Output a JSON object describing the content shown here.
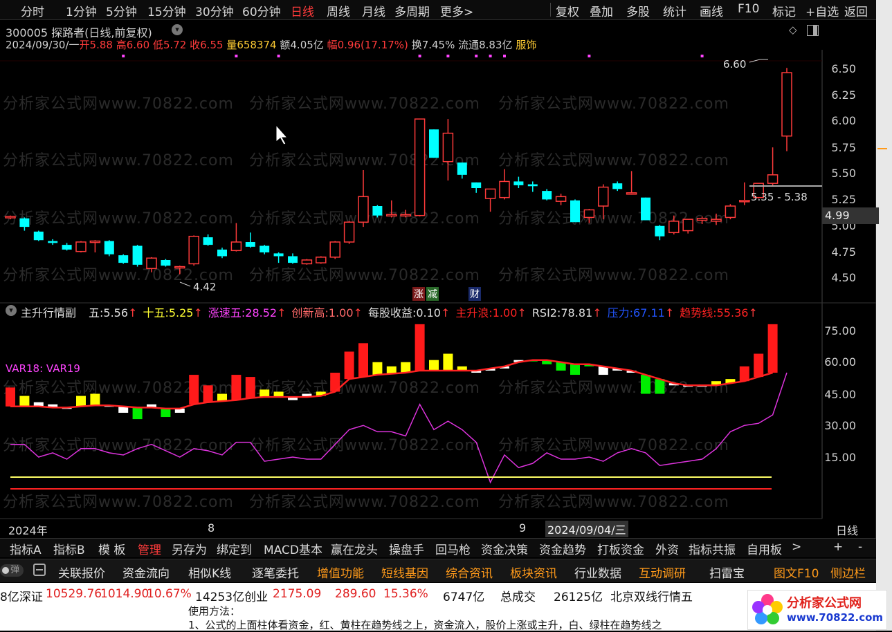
{
  "toolbar": {
    "left": [
      "分时",
      "1分钟",
      "5分钟",
      "15分钟",
      "30分钟",
      "60分钟",
      "日线",
      "周线",
      "月线",
      "多周期",
      "更多>"
    ],
    "active": "日线",
    "right": [
      "复权",
      "叠加",
      "多股",
      "统计",
      "画线",
      "F10",
      "标记",
      "+自选",
      "返回"
    ]
  },
  "stock": {
    "title": "300005 探路者(日线,前复权)",
    "date": "2024/09/30/一",
    "open_label": "开",
    "open": "5.88",
    "high_label": "高",
    "high": "6.60",
    "low_label": "低",
    "low": "5.72",
    "close_label": "收",
    "close": "6.55",
    "vol_label": "量",
    "vol": "658374",
    "amount": "额4.05亿",
    "change_label": "幅",
    "change": "0.96(17.17%)",
    "turnover": "换7.45%",
    "float": "流通8.83亿",
    "sector": "服饰"
  },
  "price_axis": [
    "6.50",
    "6.25",
    "6.00",
    "5.75",
    "5.50",
    "5.25",
    "5.00",
    "4.75",
    "4.50"
  ],
  "annotations": {
    "high_marker": "6.60",
    "low_marker": "4.42",
    "range_box": "5.35 - 5.38",
    "current_price": "4.99",
    "badge_zhang": "涨",
    "badge_jian": "减",
    "badge_cai": "财"
  },
  "indicator": {
    "name": "主升行情副",
    "items": [
      {
        "label": "五:",
        "value": "5.56",
        "color": "#e0e0e0"
      },
      {
        "label": "十五:",
        "value": "5.25",
        "color": "#ffff33"
      },
      {
        "label": "涨速五:",
        "value": "28.52",
        "color": "#ff44ff"
      },
      {
        "label": "创新高:",
        "value": "1.00",
        "color": "#ff6a6a"
      },
      {
        "label": "每股收益:",
        "value": "0.10",
        "color": "#e0e0e0"
      },
      {
        "label": "主升浪:",
        "value": "1.00",
        "color": "#ff2222"
      },
      {
        "label": "RSI2:",
        "value": "78.81",
        "color": "#e0e0e0"
      },
      {
        "label": "压力:",
        "value": "67.11",
        "color": "#2255ff"
      },
      {
        "label": "趋势线:",
        "value": "55.36",
        "color": "#ff2222"
      }
    ],
    "var_label": "VAR18: VAR19",
    "axis": [
      "75.00",
      "60.00",
      "45.00",
      "30.00",
      "15.00"
    ]
  },
  "time_axis": {
    "year": "2024年",
    "m8": "8",
    "m9": "9",
    "cursor_date": "2024/09/04/三",
    "period": "日线"
  },
  "watermark": "分析家公式网www.70822.com",
  "tabs": [
    "指标A",
    "指标B",
    "模 板",
    "管理",
    "另存为",
    "绑定到",
    "MACD基本",
    "赢在龙头",
    "操盘手",
    "回马枪",
    "资金决策",
    "资金趋势",
    "打板资金",
    "外资",
    "指标共振",
    "自用板",
    ">",
    "+",
    "-"
  ],
  "tabs_active": "管理",
  "funcbar": {
    "toggle": "弹",
    "items": [
      {
        "label": "关联报价",
        "orange": false
      },
      {
        "label": "资金流向",
        "orange": false
      },
      {
        "label": "相似K线",
        "orange": false
      },
      {
        "label": "逐笔委托",
        "orange": false
      },
      {
        "label": "增值功能",
        "orange": true
      },
      {
        "label": "短线基因",
        "orange": true
      },
      {
        "label": "综合资讯",
        "orange": true
      },
      {
        "label": "板块资讯",
        "orange": true
      },
      {
        "label": "行业数据",
        "orange": false
      },
      {
        "label": "互动调研",
        "orange": true
      },
      {
        "label": "扫雷宝",
        "orange": false
      },
      {
        "label": "图文F10",
        "orange": true
      },
      {
        "label": "侧边栏",
        "orange": true
      }
    ]
  },
  "ticker": {
    "a": "8亿深证",
    "b": "10529.76",
    "c": "1014.90",
    "d": "10.67%",
    "e": "14253亿创业",
    "f": "2175.09",
    "g": "289.60",
    "h": "15.36%",
    "i": "6747亿",
    "j": "总成交",
    "k": "26125亿",
    "l": "北京双线行情五"
  },
  "doc": {
    "line1": "使用方法：",
    "line2": "1、公式的上面柱体看资金，红、黄柱在趋势线之上，资金流入，股价上涨或主升，白、绿柱在趋势线之"
  },
  "logo": {
    "name": "分析家公式网",
    "url": "www.70822.com"
  },
  "colors": {
    "up": "#ff3b3b",
    "down": "#00ffff",
    "bg": "#000000",
    "accent": "#ff3b3b"
  },
  "chart_data": {
    "type": "candlestick",
    "ylim": [
      4.4,
      6.65
    ],
    "candles": [
      {
        "o": 5.02,
        "h": 5.04,
        "l": 5.0,
        "c": 5.03
      },
      {
        "o": 5.01,
        "h": 5.02,
        "l": 4.88,
        "c": 4.92
      },
      {
        "o": 4.87,
        "h": 4.88,
        "l": 4.77,
        "c": 4.78
      },
      {
        "o": 4.77,
        "h": 4.79,
        "l": 4.73,
        "c": 4.75
      },
      {
        "o": 4.73,
        "h": 4.75,
        "l": 4.67,
        "c": 4.68
      },
      {
        "o": 4.66,
        "h": 4.77,
        "l": 4.65,
        "c": 4.76
      },
      {
        "o": 4.77,
        "h": 4.78,
        "l": 4.65,
        "c": 4.77
      },
      {
        "o": 4.77,
        "h": 4.78,
        "l": 4.61,
        "c": 4.63
      },
      {
        "o": 4.62,
        "h": 4.63,
        "l": 4.53,
        "c": 4.54
      },
      {
        "o": 4.72,
        "h": 4.73,
        "l": 4.5,
        "c": 4.52
      },
      {
        "o": 4.48,
        "h": 4.6,
        "l": 4.44,
        "c": 4.59
      },
      {
        "o": 4.57,
        "h": 4.58,
        "l": 4.5,
        "c": 4.51
      },
      {
        "o": 4.49,
        "h": 4.51,
        "l": 4.42,
        "c": 4.5
      },
      {
        "o": 4.53,
        "h": 4.83,
        "l": 4.51,
        "c": 4.82
      },
      {
        "o": 4.81,
        "h": 4.84,
        "l": 4.72,
        "c": 4.73
      },
      {
        "o": 4.68,
        "h": 4.7,
        "l": 4.59,
        "c": 4.61
      },
      {
        "o": 4.67,
        "h": 4.96,
        "l": 4.66,
        "c": 4.76
      },
      {
        "o": 4.76,
        "h": 4.86,
        "l": 4.7,
        "c": 4.71
      },
      {
        "o": 4.72,
        "h": 4.73,
        "l": 4.63,
        "c": 4.65
      },
      {
        "o": 4.64,
        "h": 4.65,
        "l": 4.54,
        "c": 4.61
      },
      {
        "o": 4.61,
        "h": 4.64,
        "l": 4.53,
        "c": 4.54
      },
      {
        "o": 4.53,
        "h": 4.58,
        "l": 4.52,
        "c": 4.57
      },
      {
        "o": 4.54,
        "h": 4.61,
        "l": 4.53,
        "c": 4.6
      },
      {
        "o": 4.6,
        "h": 4.77,
        "l": 4.58,
        "c": 4.76
      },
      {
        "o": 4.76,
        "h": 4.98,
        "l": 4.74,
        "c": 4.97
      },
      {
        "o": 4.97,
        "h": 5.52,
        "l": 4.92,
        "c": 5.24
      },
      {
        "o": 5.14,
        "h": 5.15,
        "l": 5.02,
        "c": 5.04
      },
      {
        "o": 5.04,
        "h": 5.2,
        "l": 5.02,
        "c": 5.05
      },
      {
        "o": 5.04,
        "h": 5.1,
        "l": 5.02,
        "c": 5.05
      },
      {
        "o": 5.04,
        "h": 6.06,
        "l": 5.03,
        "c": 6.06
      },
      {
        "o": 5.95,
        "h": 5.95,
        "l": 5.65,
        "c": 5.65
      },
      {
        "o": 5.61,
        "h": 6.06,
        "l": 5.41,
        "c": 5.91
      },
      {
        "o": 5.6,
        "h": 5.6,
        "l": 5.43,
        "c": 5.47
      },
      {
        "o": 5.39,
        "h": 5.39,
        "l": 5.28,
        "c": 5.33
      },
      {
        "o": 5.22,
        "h": 5.32,
        "l": 5.08,
        "c": 5.32
      },
      {
        "o": 5.23,
        "h": 5.53,
        "l": 5.21,
        "c": 5.4
      },
      {
        "o": 5.4,
        "h": 5.45,
        "l": 5.33,
        "c": 5.36
      },
      {
        "o": 5.37,
        "h": 5.4,
        "l": 5.29,
        "c": 5.35
      },
      {
        "o": 5.3,
        "h": 5.32,
        "l": 5.2,
        "c": 5.21
      },
      {
        "o": 5.19,
        "h": 5.27,
        "l": 5.15,
        "c": 5.24
      },
      {
        "o": 5.2,
        "h": 5.21,
        "l": 4.97,
        "c": 4.97
      },
      {
        "o": 5.02,
        "h": 5.11,
        "l": 4.96,
        "c": 5.1
      },
      {
        "o": 5.14,
        "h": 5.37,
        "l": 5.0,
        "c": 5.34
      },
      {
        "o": 5.38,
        "h": 5.4,
        "l": 5.3,
        "c": 5.32
      },
      {
        "o": 5.28,
        "h": 5.51,
        "l": 5.26,
        "c": 5.28
      },
      {
        "o": 5.23,
        "h": 5.23,
        "l": 4.99,
        "c": 4.99
      },
      {
        "o": 4.93,
        "h": 4.94,
        "l": 4.78,
        "c": 4.82
      },
      {
        "o": 4.86,
        "h": 5.04,
        "l": 4.84,
        "c": 4.98
      },
      {
        "o": 4.88,
        "h": 5.0,
        "l": 4.85,
        "c": 5.0
      },
      {
        "o": 4.99,
        "h": 5.03,
        "l": 4.95,
        "c": 5.01
      },
      {
        "o": 4.98,
        "h": 5.06,
        "l": 4.94,
        "c": 5.0
      },
      {
        "o": 5.02,
        "h": 5.16,
        "l": 5.0,
        "c": 5.14
      },
      {
        "o": 5.2,
        "h": 5.39,
        "l": 5.15,
        "c": 5.2
      },
      {
        "o": 5.23,
        "h": 5.38,
        "l": 5.22,
        "c": 5.38
      },
      {
        "o": 5.38,
        "h": 5.76,
        "l": 5.36,
        "c": 5.47
      },
      {
        "o": 5.88,
        "h": 6.6,
        "l": 5.72,
        "c": 6.55
      }
    ],
    "hist": [
      {
        "v": 48,
        "t": "red"
      },
      {
        "v": 44,
        "t": "yellow"
      },
      {
        "v": 41,
        "t": "white"
      },
      {
        "v": 40,
        "t": "white"
      },
      {
        "v": 38,
        "t": "white"
      },
      {
        "v": 44,
        "t": "yellow"
      },
      {
        "v": 45,
        "t": "yellow"
      },
      {
        "v": 39,
        "t": "white"
      },
      {
        "v": 36,
        "t": "white"
      },
      {
        "v": 33,
        "t": "green"
      },
      {
        "v": 40,
        "t": "white"
      },
      {
        "v": 34,
        "t": "green"
      },
      {
        "v": 36,
        "t": "white"
      },
      {
        "v": 54,
        "t": "red"
      },
      {
        "v": 49,
        "t": "red"
      },
      {
        "v": 45,
        "t": "yellow"
      },
      {
        "v": 54,
        "t": "red"
      },
      {
        "v": 53,
        "t": "red"
      },
      {
        "v": 47,
        "t": "yellow"
      },
      {
        "v": 46,
        "t": "yellow"
      },
      {
        "v": 42,
        "t": "white"
      },
      {
        "v": 45,
        "t": "white"
      },
      {
        "v": 46,
        "t": "yellow"
      },
      {
        "v": 55,
        "t": "red"
      },
      {
        "v": 65,
        "t": "red"
      },
      {
        "v": 69,
        "t": "red"
      },
      {
        "v": 60,
        "t": "yellow"
      },
      {
        "v": 58,
        "t": "yellow"
      },
      {
        "v": 60,
        "t": "yellow"
      },
      {
        "v": 78,
        "t": "red"
      },
      {
        "v": 61,
        "t": "yellow"
      },
      {
        "v": 64,
        "t": "yellow"
      },
      {
        "v": 58,
        "t": "yellow"
      },
      {
        "v": 55,
        "t": "white"
      },
      {
        "v": 56,
        "t": "white"
      },
      {
        "v": 57,
        "t": "white"
      },
      {
        "v": 61,
        "t": "white"
      },
      {
        "v": 61,
        "t": "green"
      },
      {
        "v": 59,
        "t": "green"
      },
      {
        "v": 56,
        "t": "green"
      },
      {
        "v": 54,
        "t": "green"
      },
      {
        "v": 58,
        "t": "green"
      },
      {
        "v": 54,
        "t": "white"
      },
      {
        "v": 56,
        "t": "white"
      },
      {
        "v": 55,
        "t": "white"
      },
      {
        "v": 45,
        "t": "green"
      },
      {
        "v": 45,
        "t": "green"
      },
      {
        "v": 49,
        "t": "white"
      },
      {
        "v": 49,
        "t": "white"
      },
      {
        "v": 49,
        "t": "white"
      },
      {
        "v": 51,
        "t": "yellow"
      },
      {
        "v": 52,
        "t": "yellow"
      },
      {
        "v": 58,
        "t": "red"
      },
      {
        "v": 64,
        "t": "red"
      },
      {
        "v": 78,
        "t": "red"
      }
    ],
    "trend": [
      39,
      39,
      39,
      38.5,
      38.5,
      39,
      39.5,
      39.5,
      39,
      38.5,
      38.5,
      38,
      38,
      40,
      41,
      41.5,
      42,
      43,
      43.5,
      43.5,
      43.5,
      43.5,
      44,
      46,
      52,
      53,
      54,
      54.5,
      55,
      56,
      56,
      56,
      56,
      56,
      57,
      58,
      60,
      61,
      61,
      60,
      59,
      59,
      58,
      57,
      56,
      54,
      52,
      50,
      49,
      49,
      49,
      50,
      51,
      53,
      55
    ],
    "rsi": [
      21,
      21,
      15,
      17,
      14,
      19,
      19,
      17,
      16,
      19,
      21,
      18,
      15,
      19,
      18,
      16,
      22,
      22,
      13,
      14,
      15,
      14,
      14,
      21,
      28,
      30,
      27,
      27,
      25,
      40,
      28,
      32,
      28,
      22,
      3,
      16,
      10,
      12,
      17,
      14,
      14,
      15,
      13,
      17,
      19,
      17,
      11,
      12,
      13,
      14,
      19,
      27,
      30,
      31,
      35,
      55
    ]
  }
}
